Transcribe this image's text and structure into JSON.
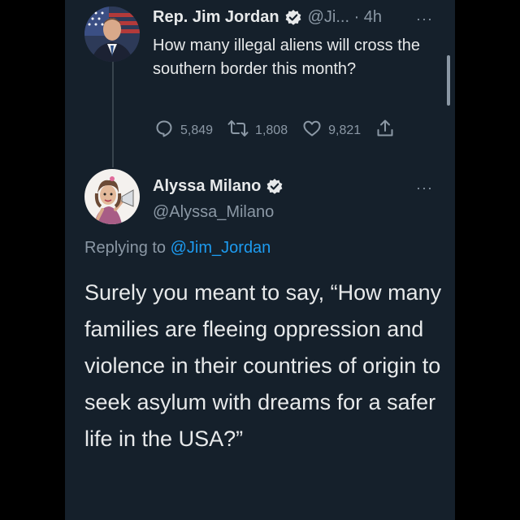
{
  "tweet1": {
    "name": "Rep. Jim Jordan",
    "handle_time": "@Ji... · 4h",
    "text": "How many illegal aliens will cross the southern border this month?",
    "stats": {
      "replies": "5,849",
      "retweets": "1,808",
      "likes": "9,821"
    },
    "more": "···"
  },
  "tweet2": {
    "name": "Alyssa Milano",
    "handle": "@Alyssa_Milano",
    "more": "···",
    "replying_prefix": "Replying to",
    "replying_mention": "@Jim_Jordan",
    "text": "Surely you meant to say, “How many families are fleeing oppression and violence in their countries of origin to seek asylum with dreams for a safer life in the USA?”"
  },
  "colors": {
    "background": "#15202b",
    "text": "#e7e9ea",
    "secondary": "#8b98a5",
    "accent": "#1d9bf0"
  },
  "icons": [
    "verified-badge-icon",
    "reply-icon",
    "retweet-icon",
    "like-icon",
    "share-icon",
    "more-icon"
  ]
}
